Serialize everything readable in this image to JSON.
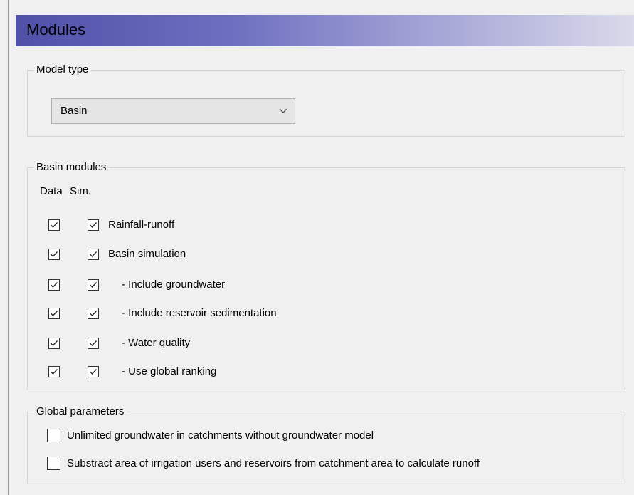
{
  "panel": {
    "title": "Modules"
  },
  "model_type": {
    "legend": "Model type",
    "selected": "Basin"
  },
  "basin_modules": {
    "legend": "Basin modules",
    "col_data": "Data",
    "col_sim": "Sim.",
    "rows": [
      {
        "label": "Rainfall-runoff",
        "data_checked": true,
        "sim_checked": true
      },
      {
        "label": "Basin simulation",
        "data_checked": true,
        "sim_checked": true
      },
      {
        "label": "- Include groundwater",
        "data_checked": true,
        "sim_checked": true
      },
      {
        "label": "- Include reservoir sedimentation",
        "data_checked": true,
        "sim_checked": true
      },
      {
        "label": "- Water quality",
        "data_checked": true,
        "sim_checked": true
      },
      {
        "label": "- Use global ranking",
        "data_checked": true,
        "sim_checked": true
      }
    ]
  },
  "global_parameters": {
    "legend": "Global parameters",
    "options": [
      {
        "label": "Unlimited groundwater in catchments without groundwater model",
        "checked": false
      },
      {
        "label": "Substract area of irrigation users and reservoirs from catchment area to calculate runoff",
        "checked": false
      }
    ]
  }
}
